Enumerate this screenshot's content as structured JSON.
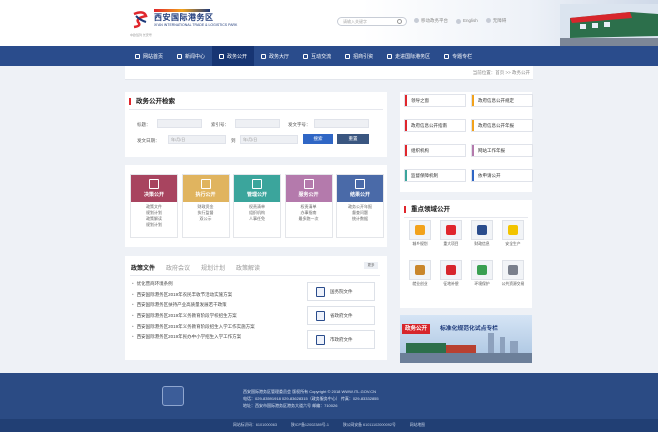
{
  "header": {
    "logo_cn": "西安国际港务区",
    "logo_en": "XI'AN INTERNATIONAL TRADE & LOGISTICS PARK",
    "logo_sub": "中欧班列  长安号",
    "search_placeholder": "请输入关键字",
    "top_links": [
      "移动政务平台",
      "English",
      "无障碍"
    ]
  },
  "nav": {
    "items": [
      "网站首页",
      "新闻中心",
      "政务公开",
      "政务大厅",
      "互动交流",
      "招商引资",
      "走进国际港务区",
      "专题专栏"
    ],
    "active_index": 2
  },
  "breadcrumb": "当前位置：首页 >> 政务公开",
  "search_panel": {
    "title": "政务公开检索",
    "labels": {
      "title": "标题：",
      "index": "索引号：",
      "doc": "发文字号：",
      "date": "发文日期：",
      "to": "到"
    },
    "date_placeholder": "年/月/日",
    "search_button": "搜索",
    "reset_button": "重置"
  },
  "cards": [
    {
      "label": "决策公开",
      "color": "#a8445f",
      "items": [
        "政策文件",
        "规划计划",
        "政策解读",
        "规划计划"
      ]
    },
    {
      "label": "执行公开",
      "color": "#e0b45f",
      "items": [
        "财政资金",
        "执行监督",
        "双公示"
      ]
    },
    {
      "label": "管理公开",
      "color": "#3ba59c",
      "items": [
        "权责清单",
        "组织机构",
        "人事任免"
      ]
    },
    {
      "label": "服务公开",
      "color": "#b47aac",
      "items": [
        "权责清单",
        "办事指南",
        "最多跑一次"
      ]
    },
    {
      "label": "结果公开",
      "color": "#4a6aa8",
      "items": [
        "政务公开年报",
        "督查问题",
        "统计数据"
      ]
    }
  ],
  "policy": {
    "tabs": [
      "政策文件",
      "政府会议",
      "规划计划",
      "政策解读"
    ],
    "more": "更多",
    "items": [
      "优化营商环境条例",
      "西安国际港务区2019年农民丰收节活动实施方案",
      "西安国际港务区扶持产业高质量发展若干政策",
      "西安国际港务区2019年义务教育阶段学校招生方案",
      "西安国际港务区2019年义务教育阶段招生入学工作实施方案",
      "西安国际港务区2019年民办中小学招生入学工作方案"
    ],
    "doc_buttons": [
      "国务院文件",
      "省政府文件",
      "市政府文件"
    ]
  },
  "quick_links": [
    {
      "label": "领导之窗",
      "color": "#e0262c"
    },
    {
      "label": "政府信息公开规定",
      "color": "#f2a21b"
    },
    {
      "label": "政府信息公开指南",
      "color": "#e0262c"
    },
    {
      "label": "政府信息公开年报",
      "color": "#f2a21b"
    },
    {
      "label": "组织机构",
      "color": "#e0262c"
    },
    {
      "label": "网站工作年报",
      "color": "#b47aac"
    },
    {
      "label": "监督保障机制",
      "color": "#3ba59c"
    },
    {
      "label": "依申请公开",
      "color": "#2f66c5"
    }
  ],
  "key_areas": {
    "title": "重点领域公开",
    "items": [
      {
        "label": "城乡规划",
        "color": "#f2a21b"
      },
      {
        "label": "重大项目",
        "color": "#e0262c"
      },
      {
        "label": "财政信息",
        "color": "#2a4c8c"
      },
      {
        "label": "安全生产",
        "color": "#f2c400"
      },
      {
        "label": "就业创业",
        "color": "#c9862a"
      },
      {
        "label": "征地补偿",
        "color": "#d7262c"
      },
      {
        "label": "环境保护",
        "color": "#3aa051"
      },
      {
        "label": "公共资源交易",
        "color": "#7a7f8c"
      }
    ]
  },
  "banner": {
    "tag": "政务公开",
    "text": "标准化规范化试点专栏"
  },
  "footer": {
    "info_lines": [
      "西安国际港务区管理委员会  版权所有  Copyright © 2018 WWW.ITL.GOV.CN",
      "电话：029-83591918  029-83628315（政务服务中心）  传真：029-83332855",
      "地址：西安市国际港务区港务大道六号  邮编：710026"
    ],
    "bottom": [
      "网站标识码：6101000063",
      "陕ICP备12002389号-1",
      "陕公网安备 61011102000092号",
      "网站地图"
    ]
  }
}
